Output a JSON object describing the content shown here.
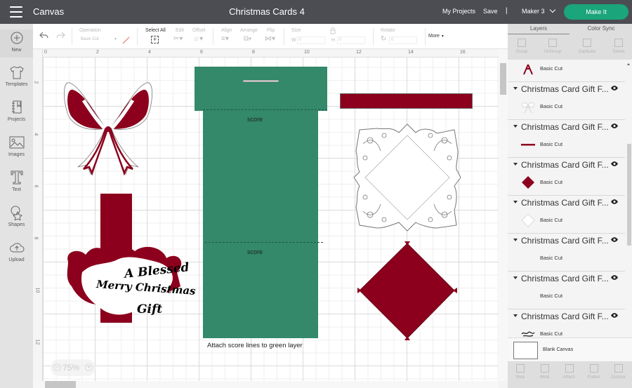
{
  "header": {
    "app_title": "Canvas",
    "document_title": "Christmas Cards 4",
    "my_projects": "My Projects",
    "save": "Save",
    "separator": "|",
    "machine": "Maker 3",
    "make_it": "Make It"
  },
  "leftbar": {
    "items": [
      {
        "label": "New",
        "icon": "plus-circle-icon"
      },
      {
        "label": "Templates",
        "icon": "tshirt-icon"
      },
      {
        "label": "Projects",
        "icon": "notebook-icon"
      },
      {
        "label": "Images",
        "icon": "image-icon"
      },
      {
        "label": "Text",
        "icon": "text-t-icon"
      },
      {
        "label": "Shapes",
        "icon": "shapes-icon"
      },
      {
        "label": "Upload",
        "icon": "cloud-upload-icon"
      }
    ]
  },
  "toolbar": {
    "operation_label": "Operation",
    "operation_value": "Basic Cut",
    "select_all": "Select All",
    "edit": "Edit",
    "offset": "Offset",
    "align": "Align",
    "arrange": "Arrange",
    "flip": "Flip",
    "size": "Size",
    "w_label": "W",
    "h_label": "H",
    "w_value": "0",
    "h_value": "0",
    "rotate": "Rotate",
    "rotate_value": "0",
    "more": "More"
  },
  "panel": {
    "tabs": [
      "Layers",
      "Color Sync"
    ],
    "active_tab": "Layers",
    "actions": [
      "Group",
      "UnGroup",
      "Duplicate",
      "Delete"
    ],
    "top_partial_sub": "Basic Cut",
    "layers": [
      {
        "name": "Christmas Card Gift F...",
        "sub": "Basic Cut",
        "thumb": "white-bow"
      },
      {
        "name": "Christmas Card Gift F...",
        "sub": "Basic Cut",
        "thumb": "red-bar"
      },
      {
        "name": "Christmas Card Gift F...",
        "sub": "Basic Cut",
        "thumb": "red-diamond"
      },
      {
        "name": "Christmas Card Gift F...",
        "sub": "Basic Cut",
        "thumb": "white-frame"
      },
      {
        "name": "Christmas Card Gift F...",
        "sub": "Basic Cut",
        "thumb": "none"
      },
      {
        "name": "Christmas Card Gift F...",
        "sub": "Basic Cut",
        "thumb": "none"
      },
      {
        "name": "Christmas Card Gift F...",
        "sub": "Basic Cut",
        "thumb": "black-script"
      }
    ],
    "blank_canvas": "Blank Canvas",
    "bottom_actions": [
      "Slice",
      "Weld",
      "Attach",
      "Flatten",
      "Contour"
    ]
  },
  "canvas": {
    "ruler_top": [
      "0",
      "2",
      "4",
      "6",
      "8",
      "10",
      "12",
      "14",
      "16"
    ],
    "ruler_left": [
      "2",
      "4",
      "6",
      "8",
      "10",
      "12"
    ],
    "score_labels": [
      "score",
      "score"
    ],
    "note": "Attach score lines to green layer",
    "sentiment_text": [
      "A Blessed",
      "Merry Christmas",
      "Gift"
    ],
    "zoom_level": "75%",
    "colors": {
      "green": "#33896a",
      "red": "#8c001d",
      "grid": "#dadada",
      "make_it": "#1aa57a"
    }
  }
}
